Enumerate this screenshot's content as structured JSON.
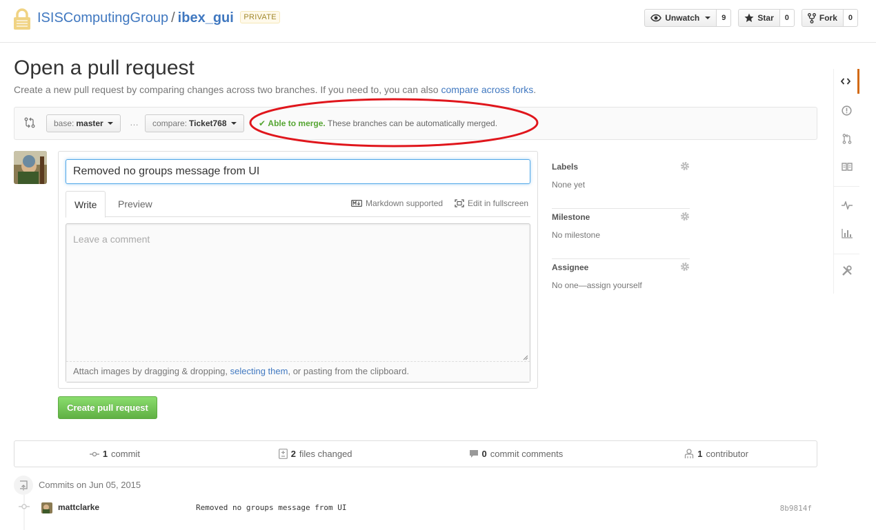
{
  "repo": {
    "owner": "ISISComputingGroup",
    "separator": "/",
    "name": "ibex_gui",
    "badge": "PRIVATE"
  },
  "actions": {
    "watch": {
      "label": "Unwatch",
      "count": "9"
    },
    "star": {
      "label": "Star",
      "count": "0"
    },
    "fork": {
      "label": "Fork",
      "count": "0"
    }
  },
  "page": {
    "title": "Open a pull request",
    "subtitle": "Create a new pull request by comparing changes across two branches. If you need to, you can also ",
    "subtitle_link": "compare across forks",
    "subtitle_end": "."
  },
  "range": {
    "base_prefix": "base:",
    "base_branch": "master",
    "dots": "…",
    "compare_prefix": "compare:",
    "compare_branch": "Ticket768",
    "merge_ok": "Able to merge.",
    "merge_text": "These branches can be automatically merged."
  },
  "form": {
    "title_value": "Removed no groups message from UI",
    "tab_write": "Write",
    "tab_preview": "Preview",
    "markdown": "Markdown supported",
    "fullscreen": "Edit in fullscreen",
    "placeholder": "Leave a comment",
    "attach_start": "Attach images by dragging & dropping, ",
    "attach_link": "selecting them",
    "attach_end": ", or pasting from the clipboard.",
    "submit": "Create pull request"
  },
  "sidebar": {
    "labels": {
      "heading": "Labels",
      "value": "None yet"
    },
    "milestone": {
      "heading": "Milestone",
      "value": "No milestone"
    },
    "assignee": {
      "heading": "Assignee",
      "value": "No one—assign yourself"
    }
  },
  "summary": {
    "commits": {
      "count": "1",
      "label": "commit"
    },
    "files": {
      "count": "2",
      "label": "files changed"
    },
    "comments": {
      "count": "0",
      "label": "commit comments"
    },
    "contributors": {
      "count": "1",
      "label": "contributor"
    }
  },
  "commits": {
    "group_title": "Commits on Jun 05, 2015",
    "items": [
      {
        "author": "mattclarke",
        "message": "Removed no groups message from UI",
        "sha": "8b9814f"
      }
    ]
  },
  "colors": {
    "accent_link": "#4078c0",
    "merge_green": "#55a532",
    "submit_green": "#60b044",
    "annotation_red": "#e0161c",
    "nav_selected": "#d26911"
  }
}
